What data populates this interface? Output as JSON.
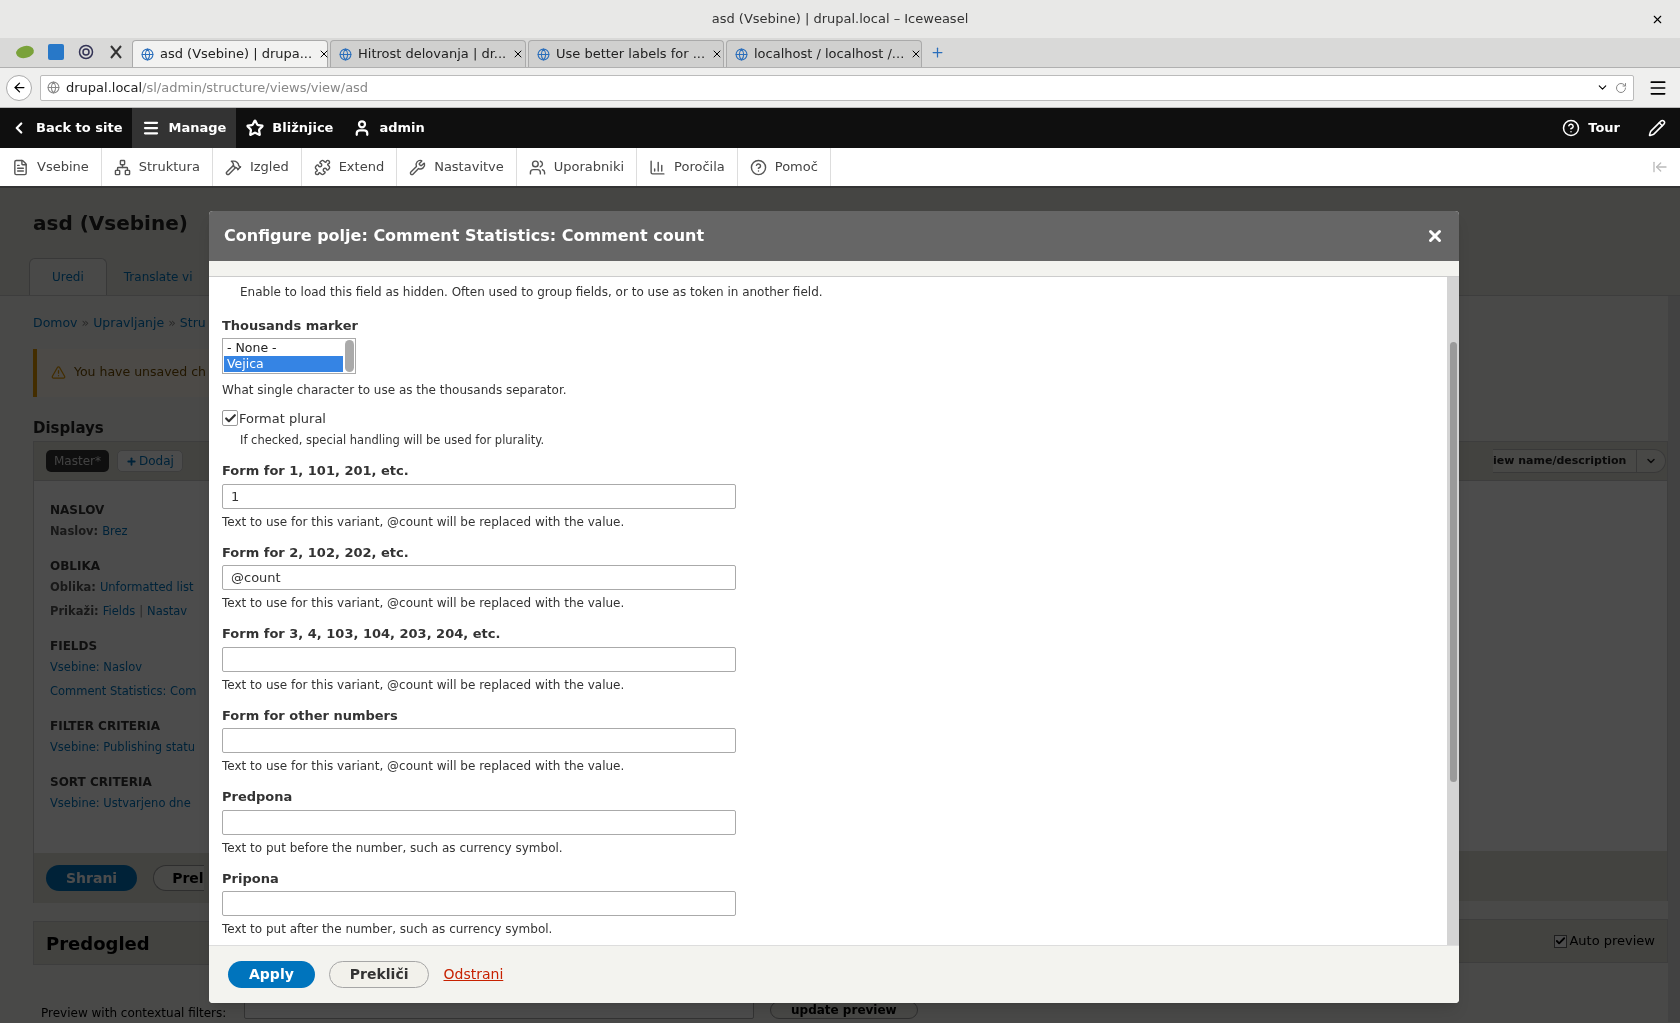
{
  "browser": {
    "title": "asd (Vsebine) | drupal.local – Iceweasel",
    "tabs": [
      {
        "label": "asd (Vsebine) | drupa...",
        "selected": true
      },
      {
        "label": "Hitrost delovanja | dr...",
        "selected": false
      },
      {
        "label": "Use better labels for ...",
        "selected": false
      },
      {
        "label": "localhost / localhost /...",
        "selected": false
      }
    ],
    "url": {
      "host": "drupal.local",
      "path": "/sl/admin/structure/views/view/asd"
    }
  },
  "toolbar": {
    "items": [
      {
        "label": "Back to site",
        "selected": false
      },
      {
        "label": "Manage",
        "selected": true
      },
      {
        "label": "Bližnjice",
        "selected": false
      },
      {
        "label": "admin",
        "selected": false
      }
    ],
    "tour": "Tour"
  },
  "tray": {
    "items": [
      "Vsebine",
      "Struktura",
      "Izgled",
      "Extend",
      "Nastavitve",
      "Uporabniki",
      "Poročila",
      "Pomoč"
    ]
  },
  "page": {
    "title": "asd (Vsebine)",
    "tabs": [
      {
        "label": "Uredi",
        "selected": true
      },
      {
        "label": "Translate vi",
        "selected": false
      }
    ],
    "breadcrumb": [
      {
        "kind": "link",
        "text": "Domov"
      },
      {
        "kind": "separator",
        "text": "»"
      },
      {
        "kind": "link",
        "text": "Upravljanje"
      },
      {
        "kind": "separator",
        "text": "»"
      },
      {
        "kind": "link",
        "text": "Stru"
      }
    ],
    "warning": "You have unsaved ch",
    "displays_heading": "Displays",
    "displays": [
      {
        "label": "Master*",
        "selected": true
      },
      {
        "label": "Dodaj",
        "selected": false
      }
    ],
    "sections": [
      {
        "heading": "NASLOV",
        "rows": [
          {
            "label": "Naslov:",
            "items": [
              {
                "kind": "link",
                "text": "Brez"
              }
            ]
          }
        ]
      },
      {
        "heading": "OBLIKA",
        "rows": [
          {
            "label": "Oblika:",
            "items": [
              {
                "kind": "link",
                "text": "Unformatted list"
              }
            ]
          },
          {
            "label": "Prikaži:",
            "items": [
              {
                "kind": "link",
                "text": "Fields"
              },
              {
                "kind": "separator",
                "text": "|"
              },
              {
                "kind": "link",
                "text": "Nastav"
              }
            ]
          }
        ]
      },
      {
        "heading": "FIELDS",
        "rows": [
          {
            "items": [
              {
                "kind": "link",
                "text": "Vsebine: Naslov"
              }
            ]
          },
          {
            "items": [
              {
                "kind": "link",
                "text": "Comment Statistics: Com"
              }
            ]
          }
        ]
      },
      {
        "heading": "FILTER CRITERIA",
        "rows": [
          {
            "items": [
              {
                "kind": "link",
                "text": "Vsebine: Publishing statu"
              }
            ]
          }
        ]
      },
      {
        "heading": "SORT CRITERIA",
        "rows": [
          {
            "items": [
              {
                "kind": "link",
                "text": "Vsebine: Ustvarjeno dne"
              }
            ]
          }
        ]
      }
    ],
    "save": "Shrani",
    "preview_button": "Prel",
    "dropdown": "iew name/description",
    "preview_heading": "Predogled",
    "preview_label": "Preview with contextual filters:",
    "auto_preview": {
      "label": "Auto preview",
      "checked": true
    },
    "update_preview": "update preview"
  },
  "dialog": {
    "title": "Configure polje: Comment Statistics: Comment count",
    "hidden_description": "Enable to load this field as hidden. Often used to group fields, or to use as token in another field.",
    "thousands": {
      "label": "Thousands marker",
      "options": [
        {
          "label": "- None -",
          "selected": false
        },
        {
          "label": "Vejica",
          "selected": true
        }
      ],
      "description": "What single character to use as the thousands separator."
    },
    "format_plural": {
      "label": "Format plural",
      "checked": true,
      "description": "If checked, special handling will be used for plurality."
    },
    "fields": [
      {
        "label": "Form for 1, 101, 201, etc.",
        "value": "1",
        "description": "Text to use for this variant, @count will be replaced with the value."
      },
      {
        "label": "Form for 2, 102, 202, etc.",
        "value": "@count",
        "description": "Text to use for this variant, @count will be replaced with the value."
      },
      {
        "label": "Form for 3, 4, 103, 104, 203, 204, etc.",
        "description": "Text to use for this variant, @count will be replaced with the value."
      },
      {
        "label": "Form for other numbers",
        "description": "Text to use for this variant, @count will be replaced with the value."
      },
      {
        "label": "Predpona",
        "description": "Text to put before the number, such as currency symbol."
      },
      {
        "label": "Pripona",
        "description": "Text to put after the number, such as currency symbol."
      }
    ],
    "buttons": {
      "apply": "Apply",
      "cancel": "Prekliči",
      "remove": "Odstrani"
    }
  }
}
